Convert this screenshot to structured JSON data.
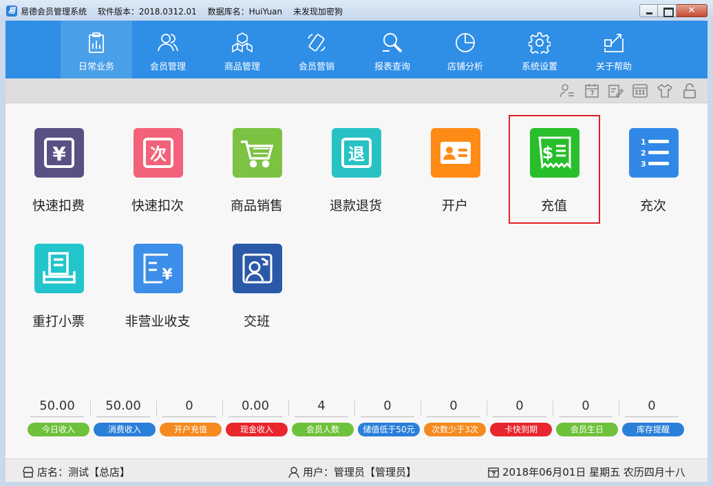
{
  "titlebar": {
    "app_name": "易德会员管理系统",
    "version": "软件版本：2018.0312.01",
    "database": "数据库名：HuiYuan",
    "dongle": "未发现加密狗",
    "app_icon_letter": "易"
  },
  "nav": {
    "items": [
      {
        "label": "日常业务",
        "icon": "clipboard-chart-icon"
      },
      {
        "label": "会员管理",
        "icon": "members-icon"
      },
      {
        "label": "商品管理",
        "icon": "cubes-icon"
      },
      {
        "label": "会员营销",
        "icon": "phone-tilt-icon"
      },
      {
        "label": "报表查询",
        "icon": "report-search-icon"
      },
      {
        "label": "店铺分析",
        "icon": "pie-chart-icon"
      },
      {
        "label": "系统设置",
        "icon": "gear-icon"
      },
      {
        "label": "关于帮助",
        "icon": "help-flag-icon"
      }
    ],
    "active_index": 0
  },
  "toolbar": {
    "icons": [
      "user-list-icon",
      "calendar-icon",
      "edit-note-icon",
      "calculator-icon",
      "shirt-icon",
      "lock-icon"
    ]
  },
  "tiles": [
    {
      "label": "快速扣费",
      "color": "#5a5084",
      "icon": "yen-box-icon",
      "glyph": "¥"
    },
    {
      "label": "快速扣次",
      "color": "#f2627a",
      "icon": "count-box-icon",
      "glyph": "次"
    },
    {
      "label": "商品销售",
      "color": "#7cc243",
      "icon": "cart-icon",
      "glyph": ""
    },
    {
      "label": "退款退货",
      "color": "#28c2c4",
      "icon": "refund-box-icon",
      "glyph": "退"
    },
    {
      "label": "开户",
      "color": "#ff8b17",
      "icon": "id-card-icon",
      "glyph": ""
    },
    {
      "label": "充值",
      "color": "#29be2b",
      "icon": "dollar-receipt-icon",
      "glyph": "$"
    },
    {
      "label": "充次",
      "color": "#3188e6",
      "icon": "numbered-list-icon",
      "glyph": ""
    },
    {
      "label": "重打小票",
      "color": "#22c5cb",
      "icon": "receipt-printer-icon",
      "glyph": ""
    },
    {
      "label": "非营业收支",
      "color": "#3d8ee8",
      "icon": "expense-yen-icon",
      "glyph": "¥"
    },
    {
      "label": "交班",
      "color": "#2a59a8",
      "icon": "shift-handover-icon",
      "glyph": ""
    }
  ],
  "stats": [
    {
      "value": "50.00",
      "label": "今日收入",
      "color": "#6ec13a"
    },
    {
      "value": "50.00",
      "label": "消费收入",
      "color": "#2a7fd9"
    },
    {
      "value": "0",
      "label": "开户充值",
      "color": "#f58a1f"
    },
    {
      "value": "0.00",
      "label": "现金收入",
      "color": "#e8262d"
    },
    {
      "value": "4",
      "label": "会员人数",
      "color": "#6ec13a"
    },
    {
      "value": "0",
      "label": "储值低于50元",
      "color": "#2a7fd9"
    },
    {
      "value": "0",
      "label": "次数少于3次",
      "color": "#f58a1f"
    },
    {
      "value": "0",
      "label": "卡快到期",
      "color": "#e8262d"
    },
    {
      "value": "0",
      "label": "会员生日",
      "color": "#6ec13a"
    },
    {
      "value": "0",
      "label": "库存提醒",
      "color": "#2a7fd9"
    }
  ],
  "statusbar": {
    "store": "店名：测试【总店】",
    "user": "用户：管理员【管理员】",
    "date": "2018年06月01日 星期五 农历四月十八"
  }
}
